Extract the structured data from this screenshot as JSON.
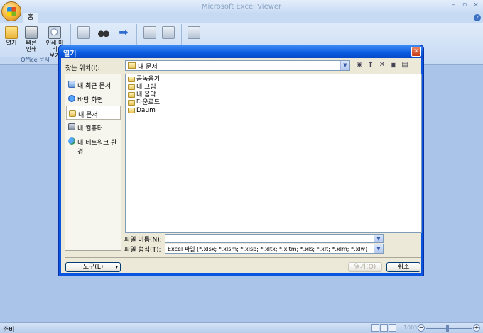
{
  "app": {
    "title": "Microsoft Excel Viewer",
    "home_tab": "홈",
    "help": "?",
    "window_controls": [
      "–",
      "▫",
      "×"
    ]
  },
  "ribbon": {
    "buttons": [
      {
        "label": "열기",
        "icon": "folder-icon"
      },
      {
        "label": "빠른\n인쇄",
        "icon": "printer-icon"
      },
      {
        "label": "인쇄 미리\n보기",
        "icon": "print-preview-icon"
      }
    ],
    "group_label": "Office 문서"
  },
  "dialog": {
    "title": "열기",
    "look_in_label": "찾는 위치(I):",
    "look_in_value": "내 문서",
    "places": [
      {
        "label": "내 최근 문서",
        "icon": "recent-docs-icon"
      },
      {
        "label": "바탕 화면",
        "icon": "desktop-icon"
      },
      {
        "label": "내 문서",
        "icon": "my-documents-icon",
        "active": true
      },
      {
        "label": "내 컴퓨터",
        "icon": "my-computer-icon"
      },
      {
        "label": "내 네트워크 환경",
        "icon": "network-icon"
      }
    ],
    "files": [
      "곰녹음기",
      "내 그림",
      "내 음악",
      "다운로드",
      "Daum"
    ],
    "file_name_label": "파일 이름(N):",
    "file_name_value": "",
    "file_type_label": "파일 형식(T):",
    "file_type_value": "Excel 파일 (*.xlsx; *.xlsm; *.xlsb; *.xltx; *.xltm; *.xls; *.xlt; *.xlm; *.xlw)",
    "tools_button": "도구(L)",
    "open_button": "열기(O)",
    "cancel_button": "취소"
  },
  "status": {
    "text": "준비",
    "zoom": "100%"
  }
}
